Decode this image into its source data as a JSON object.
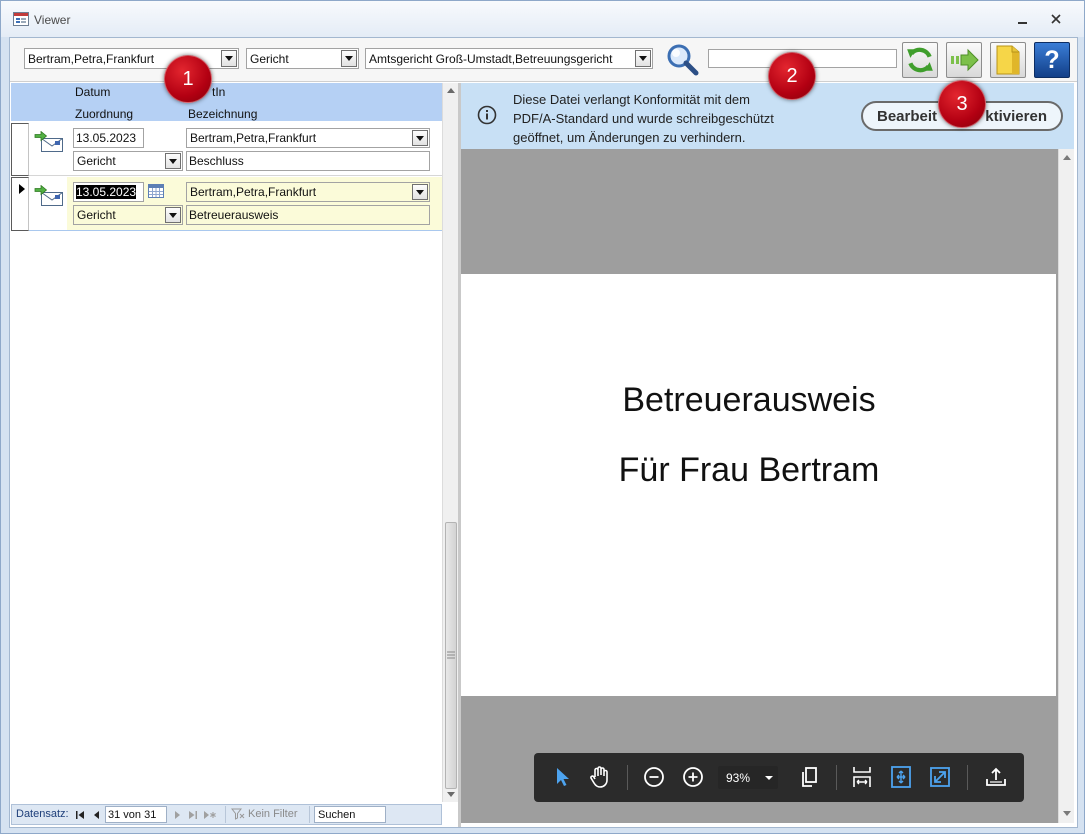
{
  "window": {
    "title": "Viewer"
  },
  "toolbar": {
    "person_combo_value": "Bertram,Petra,Frankfurt",
    "type_combo_value": "Gericht",
    "court_combo_value": "Amtsgericht Groß-Umstadt,Betreuungsgericht",
    "search_value": "",
    "help_glyph": "?"
  },
  "annotations": [
    "1",
    "2",
    "3"
  ],
  "list": {
    "header": {
      "datum": "Datum",
      "person": "tIn",
      "zuordnung": "Zuordnung",
      "bezeichnung": "Bezeichnung"
    },
    "records": [
      {
        "datum": "13.05.2023",
        "person": "Bertram,Petra,Frankfurt",
        "zuordnung": "Gericht",
        "bezeichnung": "Beschluss",
        "selected": false
      },
      {
        "datum": "13.05.2023",
        "person": "Bertram,Petra,Frankfurt",
        "zuordnung": "Gericht",
        "bezeichnung": "Betreuerausweis",
        "selected": true
      }
    ],
    "navigation": {
      "label": "Datensatz:",
      "position": "31 von 31",
      "filter_label": "Kein Filter",
      "search_value": "Suchen"
    }
  },
  "viewer": {
    "banner": {
      "lines": [
        "Diese Datei verlangt Konformität mit dem",
        "PDF/A-Standard und wurde schreibgeschützt",
        "geöffnet, um Änderungen zu verhindern."
      ],
      "button_label_left": "Bearbeit",
      "button_label_right": "ktivieren"
    },
    "document": {
      "lines": [
        "Betreuerausweis",
        "Für Frau Bertram"
      ]
    },
    "toolbar": {
      "zoom": "93%"
    }
  },
  "icons": {
    "app": "form-icon",
    "search": "magnifier-icon",
    "refresh": "refresh-icon",
    "forward": "forward-arrow-icon",
    "folder": "folder-icon",
    "help": "help-icon",
    "record": "envelope-arrow-icon",
    "calendar": "calendar-icon",
    "info": "info-icon",
    "select_tool": "cursor-icon",
    "pan_tool": "hand-icon",
    "zoom_out": "zoom-out-icon",
    "zoom_in": "zoom-in-icon",
    "page_view": "pages-icon",
    "fit_width": "fit-width-icon",
    "fit_page": "fit-page-icon",
    "full_screen": "full-screen-icon",
    "share": "upload-icon"
  },
  "colors": {
    "header": "#b5d0f4",
    "selected_row": "#fbfbd9",
    "banner": "#c8e0f5",
    "viewer_background": "#9e9e9e",
    "annotation": "#c40c14",
    "pdf_toolbar": "#2b2b2b",
    "accent": "#4da3ef"
  }
}
